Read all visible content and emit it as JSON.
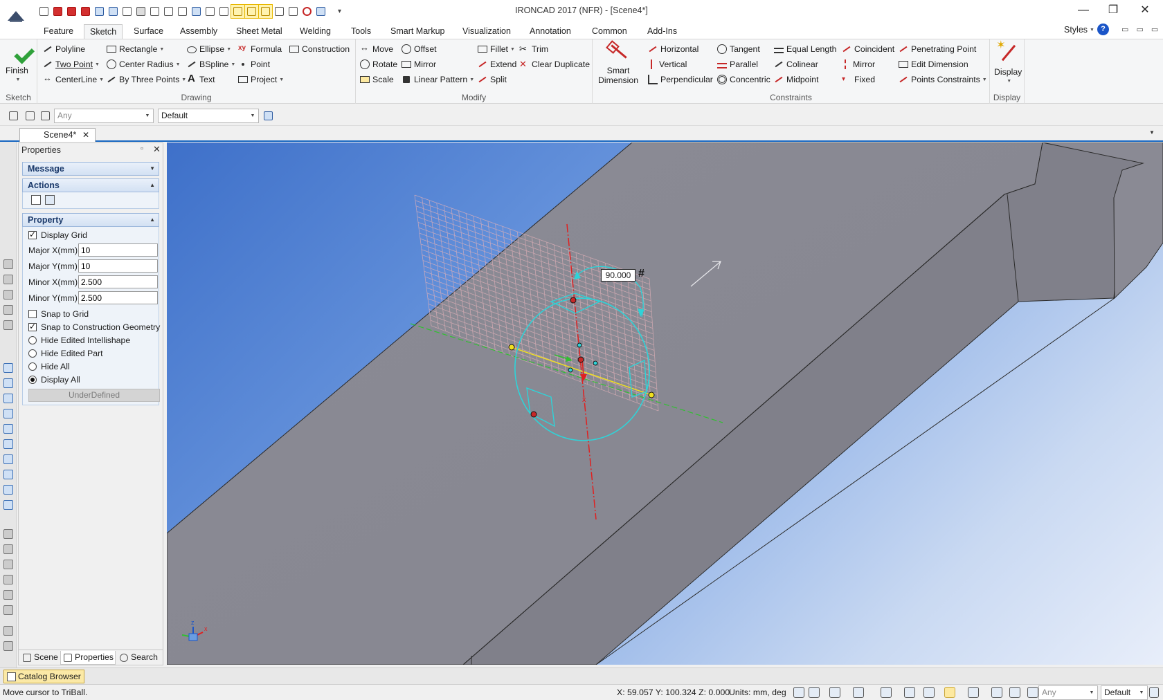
{
  "window": {
    "title": "IRONCAD 2017 (NFR) - [Scene4*]",
    "minimize": "—",
    "restore": "❐",
    "close": "✕"
  },
  "qat_more": "▾",
  "ribbon_tabs": [
    "Feature",
    "Sketch",
    "Surface",
    "Assembly",
    "Sheet Metal",
    "Welding",
    "Tools",
    "Smart Markup",
    "Visualization",
    "Annotation",
    "Common",
    "Add-Ins"
  ],
  "active_tab": "Sketch",
  "styles_label": "Styles",
  "help_label": "?",
  "ribbon_min": "▭ ▭ ▭",
  "groups": {
    "sketch": {
      "label": "Sketch",
      "finish": "Finish"
    },
    "drawing": {
      "label": "Drawing",
      "polyline": "Polyline",
      "two_point": "Two Point",
      "centerline": "CenterLine",
      "rectangle": "Rectangle",
      "center_radius": "Center Radius",
      "by_three_points": "By Three Points",
      "ellipse": "Ellipse",
      "bspline": "BSpline",
      "text": "Text",
      "formula": "Formula",
      "point": "Point",
      "project": "Project",
      "construction": "Construction"
    },
    "modify": {
      "label": "Modify",
      "move": "Move",
      "rotate": "Rotate",
      "scale": "Scale",
      "offset": "Offset",
      "mirror": "Mirror",
      "linear_pattern": "Linear Pattern",
      "fillet": "Fillet",
      "extend": "Extend",
      "split": "Split",
      "trim": "Trim",
      "clear_duplicate": "Clear Duplicate"
    },
    "constraints": {
      "label": "Constraints",
      "smart_dimension_1": "Smart",
      "smart_dimension_2": "Dimension",
      "horizontal": "Horizontal",
      "vertical": "Vertical",
      "perpendicular": "Perpendicular",
      "tangent": "Tangent",
      "parallel": "Parallel",
      "concentric": "Concentric",
      "equal_length": "Equal Length",
      "colinear": "Colinear",
      "midpoint": "Midpoint",
      "coincident": "Coincident",
      "mirror": "Mirror",
      "fixed": "Fixed",
      "penetrating_point": "Penetrating Point",
      "edit_dimension": "Edit Dimension",
      "points_constraints": "Points Constraints"
    },
    "display": {
      "label": "Display",
      "display": "Display"
    }
  },
  "toolbar2": {
    "filter_value": "Any",
    "style_value": "Default"
  },
  "doc_tab": {
    "label": "Scene4*",
    "close": "✕"
  },
  "properties": {
    "title": "Properties",
    "pin": "📌",
    "close": "✕",
    "message_label": "Message",
    "actions_label": "Actions",
    "property_label": "Property",
    "display_grid": "Display Grid",
    "major_x_label": "Major X(mm)",
    "major_x_value": "10",
    "major_y_label": "Major Y(mm)",
    "major_y_value": "10",
    "minor_x_label": "Minor X(mm)",
    "minor_x_value": "2.500",
    "minor_y_label": "Minor Y(mm)",
    "minor_y_value": "2.500",
    "snap_to_grid": "Snap to Grid",
    "snap_to_construction": "Snap to Construction Geometry",
    "hide_edited_intellishape": "Hide Edited Intellishape",
    "hide_edited_part": "Hide Edited Part",
    "hide_all": "Hide All",
    "display_all": "Display All",
    "underdefined": "UnderDefined"
  },
  "panel_tabs": {
    "scene": "Scene",
    "properties": "Properties",
    "search": "Search"
  },
  "viewport": {
    "dimension_value": "90.000",
    "dimension_hash": "#",
    "triad_z": "z",
    "triad_x": "x"
  },
  "catalog_browser": "Catalog Browser",
  "status": {
    "message": "Move cursor to TriBall.",
    "coords": "X: 59.057 Y: 100.324 Z: 0.000",
    "units": "Units: mm, deg",
    "filter": "Any",
    "style": "Default"
  },
  "colors": {
    "accent": "#1565c0",
    "finish_green": "#2fa13a",
    "sketch_cyan": "#2fd3d8",
    "axis_red": "#e02020",
    "axis_yellow": "#f0e020",
    "axis_green": "#30c030",
    "part_grey": "#8a8a94"
  }
}
